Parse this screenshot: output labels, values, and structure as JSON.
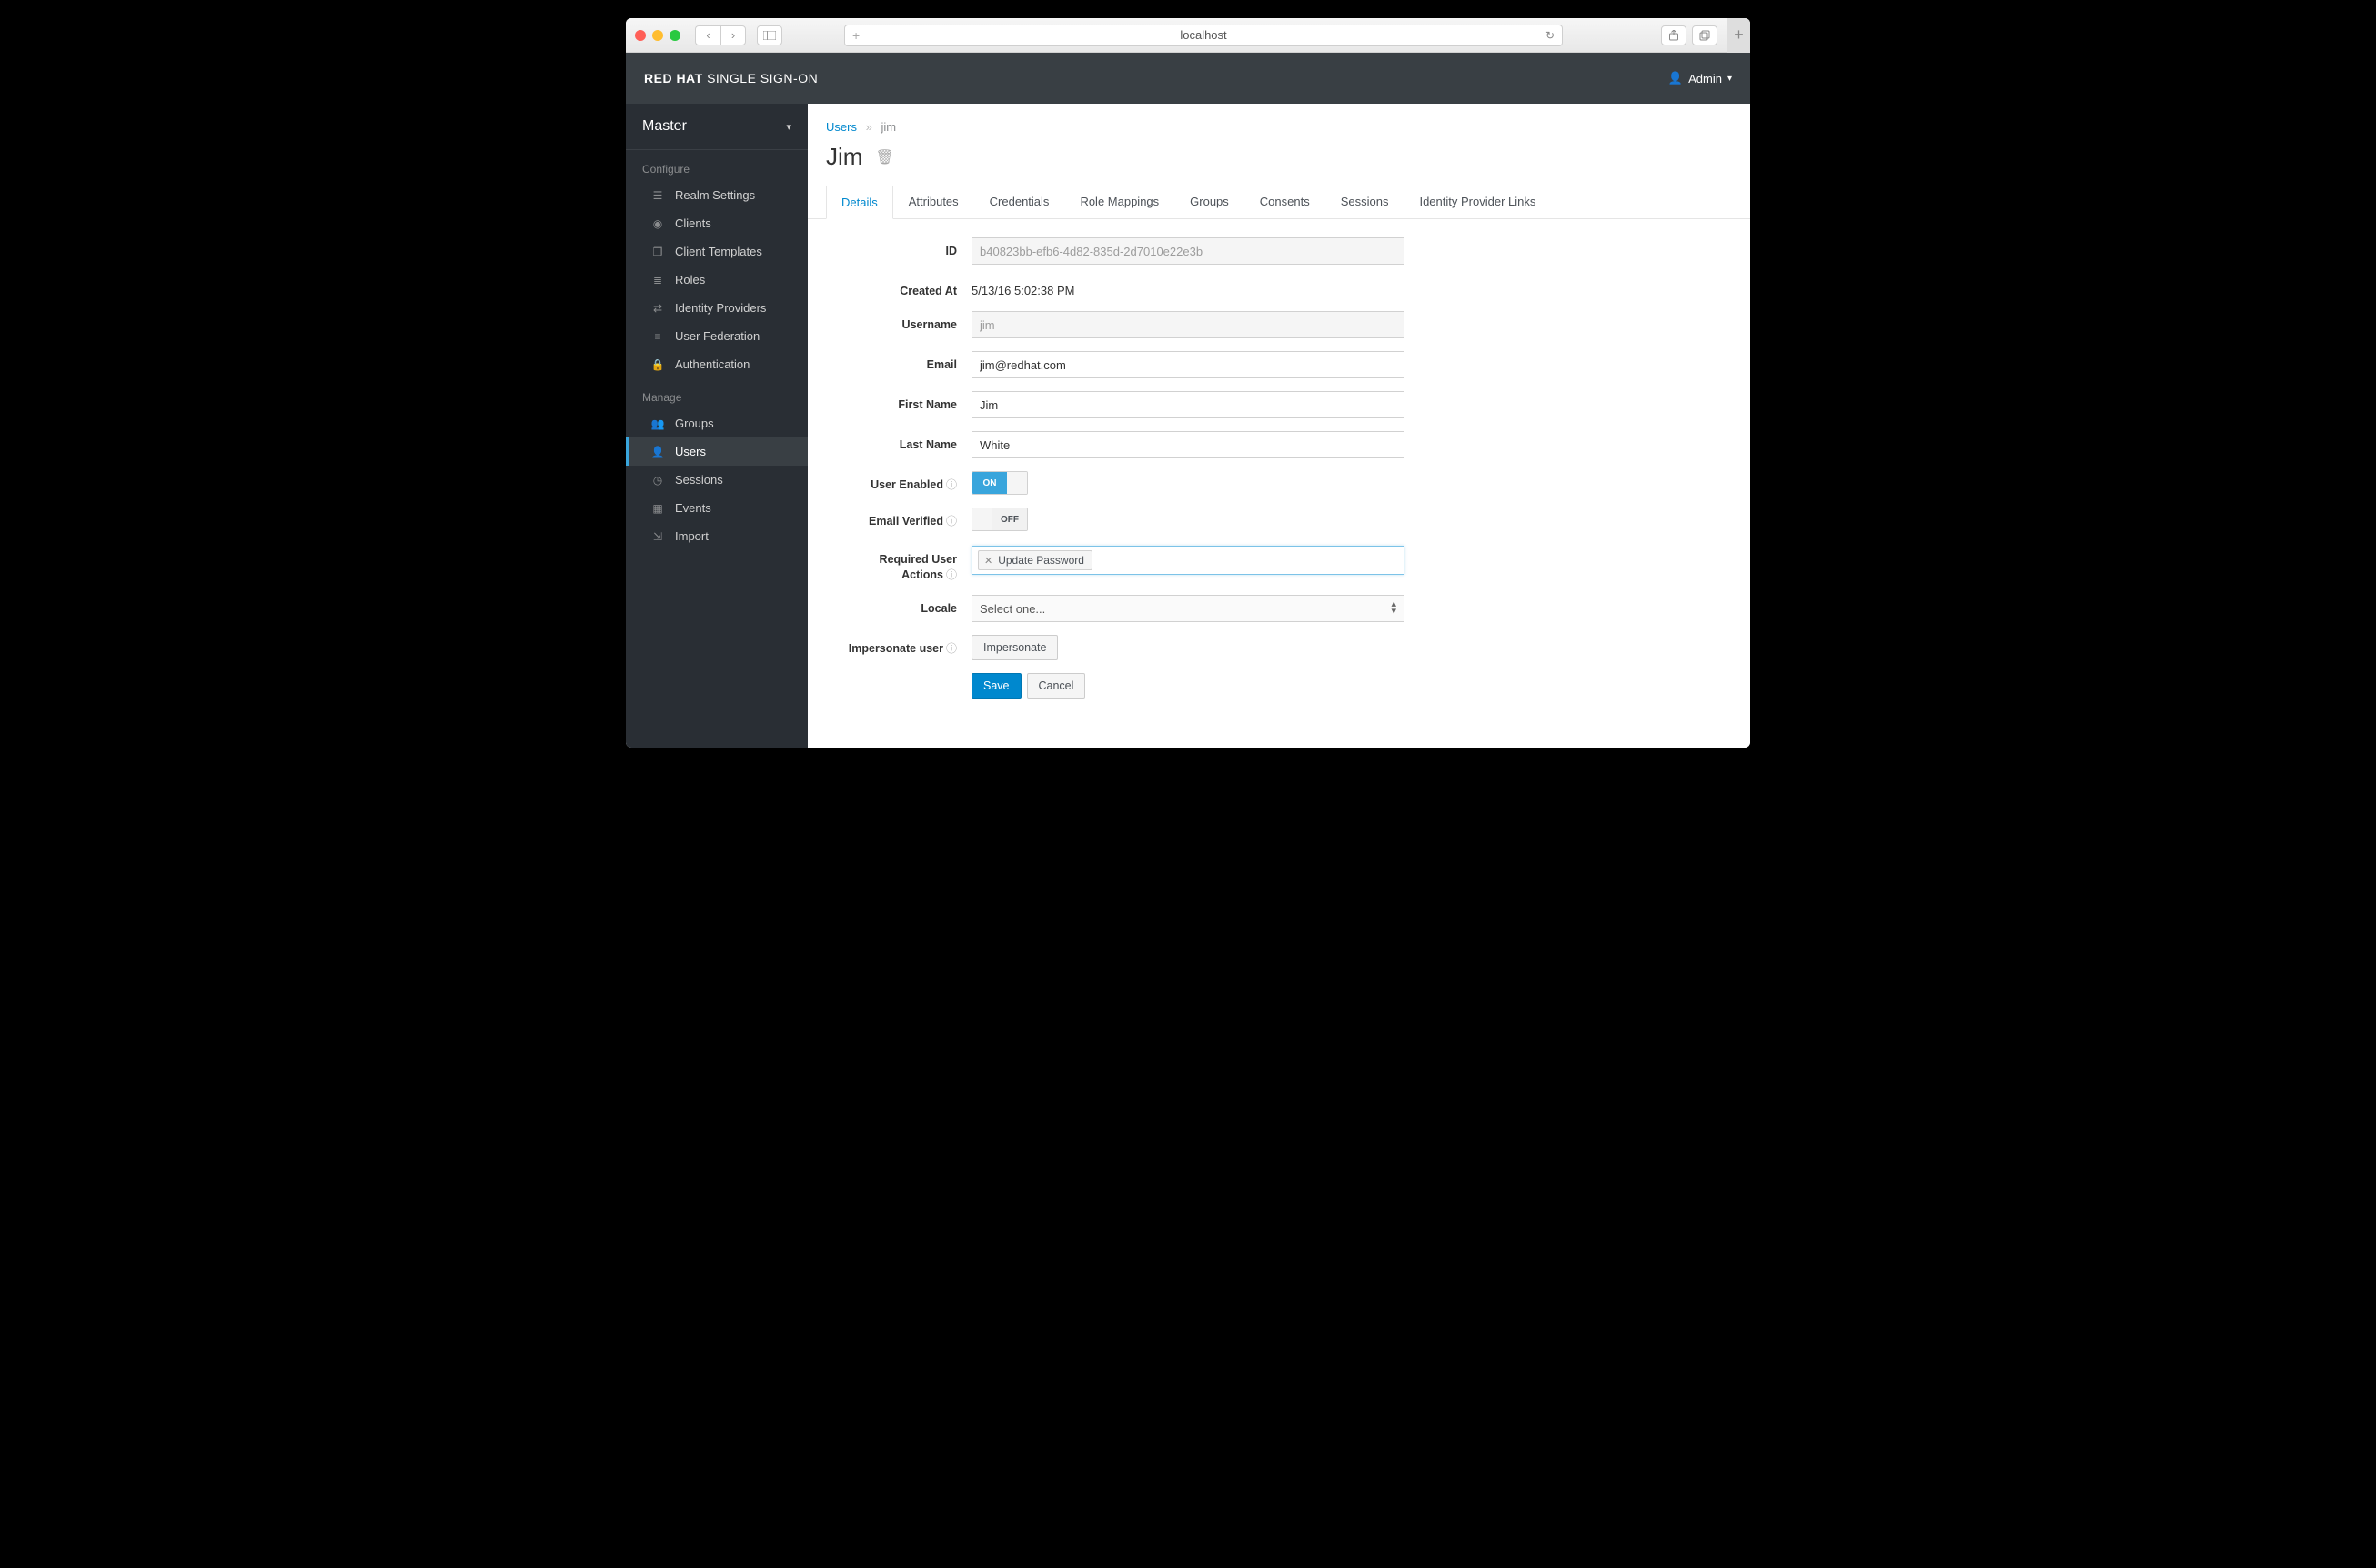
{
  "browser": {
    "url": "localhost"
  },
  "header": {
    "brand_bold": "RED HAT",
    "brand_thin": " SINGLE SIGN-ON",
    "user_label": "Admin"
  },
  "sidebar": {
    "realm": "Master",
    "section_configure": "Configure",
    "section_manage": "Manage",
    "configure_items": [
      "Realm Settings",
      "Clients",
      "Client Templates",
      "Roles",
      "Identity Providers",
      "User Federation",
      "Authentication"
    ],
    "manage_items": [
      "Groups",
      "Users",
      "Sessions",
      "Events",
      "Import"
    ]
  },
  "breadcrumb": {
    "root": "Users",
    "current": "jim"
  },
  "page": {
    "title": "Jim"
  },
  "tabs": [
    "Details",
    "Attributes",
    "Credentials",
    "Role Mappings",
    "Groups",
    "Consents",
    "Sessions",
    "Identity Provider Links"
  ],
  "form": {
    "id_label": "ID",
    "id_value": "b40823bb-efb6-4d82-835d-2d7010e22e3b",
    "created_label": "Created At",
    "created_value": "5/13/16 5:02:38 PM",
    "username_label": "Username",
    "username_value": "jim",
    "email_label": "Email",
    "email_value": "jim@redhat.com",
    "firstname_label": "First Name",
    "firstname_value": "Jim",
    "lastname_label": "Last Name",
    "lastname_value": "White",
    "user_enabled_label": "User Enabled",
    "user_enabled_on": "ON",
    "email_verified_label": "Email Verified",
    "email_verified_off": "OFF",
    "required_actions_label": "Required User Actions",
    "required_actions_tag": "Update Password",
    "locale_label": "Locale",
    "locale_placeholder": "Select one...",
    "impersonate_label": "Impersonate user",
    "impersonate_btn": "Impersonate",
    "save": "Save",
    "cancel": "Cancel"
  }
}
